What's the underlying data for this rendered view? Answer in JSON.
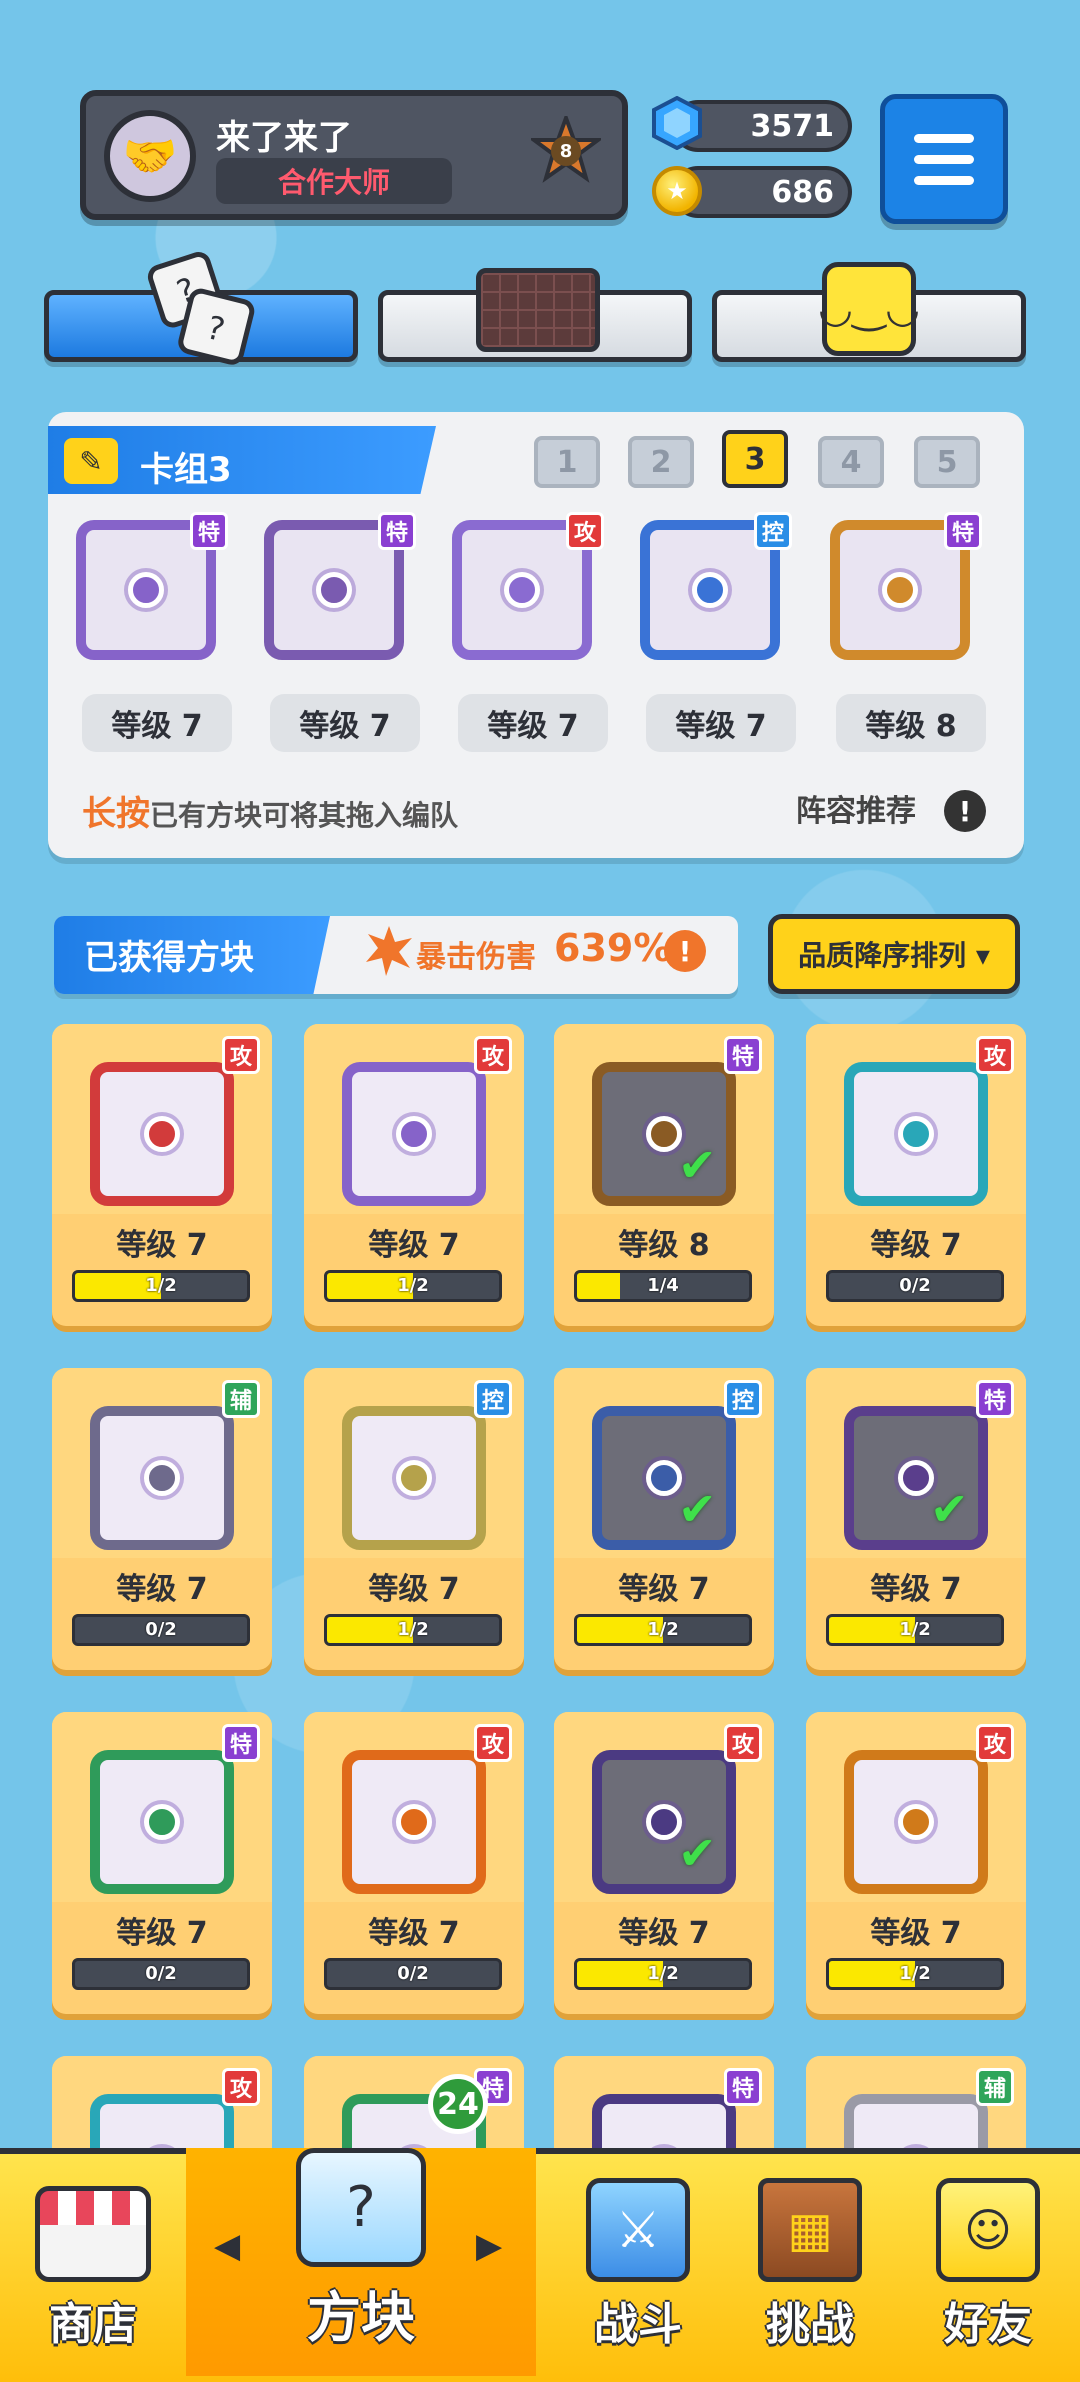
{
  "profile": {
    "name": "来了来了",
    "title": "合作大师",
    "rank_level": "8",
    "avatar_icon": "handshake-icon"
  },
  "currency": {
    "gems": "3571",
    "coins": "686"
  },
  "deck": {
    "title": "卡组3",
    "slots": [
      "1",
      "2",
      "3",
      "4",
      "5"
    ],
    "active_slot": "3",
    "cards": [
      {
        "type": "特",
        "level": "等级 7",
        "color": "#8663c9"
      },
      {
        "type": "特",
        "level": "等级 7",
        "color": "#7a5bb0"
      },
      {
        "type": "攻",
        "level": "等级 7",
        "color": "#8a6bd1"
      },
      {
        "type": "控",
        "level": "等级 7",
        "color": "#3a73d6"
      },
      {
        "type": "特",
        "level": "等级 8",
        "color": "#d08a2c"
      }
    ],
    "hint_em": "长按",
    "hint_text": "已有方块可将其拖入编队",
    "recommend": "阵容推荐"
  },
  "obtained": {
    "title": "已获得方块",
    "crit_label": "暴击伤害",
    "crit_value": "639%",
    "sort_label": "品质降序排列 ▾"
  },
  "grid": [
    {
      "type": "攻",
      "level": "等级 7",
      "progress": "1/2",
      "fraction": 0.5,
      "checked": false,
      "color": "#d23b3b"
    },
    {
      "type": "攻",
      "level": "等级 7",
      "progress": "1/2",
      "fraction": 0.5,
      "checked": false,
      "color": "#8663c9"
    },
    {
      "type": "特",
      "level": "等级 8",
      "progress": "1/4",
      "fraction": 0.25,
      "checked": true,
      "color": "#8a5b24"
    },
    {
      "type": "攻",
      "level": "等级 7",
      "progress": "0/2",
      "fraction": 0,
      "checked": false,
      "color": "#29a7b8"
    },
    {
      "type": "辅",
      "level": "等级 7",
      "progress": "0/2",
      "fraction": 0,
      "checked": false,
      "color": "#6e6a8c"
    },
    {
      "type": "控",
      "level": "等级 7",
      "progress": "1/2",
      "fraction": 0.5,
      "checked": false,
      "color": "#b5a24b"
    },
    {
      "type": "控",
      "level": "等级 7",
      "progress": "1/2",
      "fraction": 0.5,
      "checked": true,
      "color": "#3b5da8"
    },
    {
      "type": "特",
      "level": "等级 7",
      "progress": "1/2",
      "fraction": 0.5,
      "checked": true,
      "color": "#5a3e8c"
    },
    {
      "type": "特",
      "level": "等级 7",
      "progress": "0/2",
      "fraction": 0,
      "checked": false,
      "color": "#2f9b5a"
    },
    {
      "type": "攻",
      "level": "等级 7",
      "progress": "0/2",
      "fraction": 0,
      "checked": false,
      "color": "#e06a1a"
    },
    {
      "type": "攻",
      "level": "等级 7",
      "progress": "1/2",
      "fraction": 0.5,
      "checked": true,
      "color": "#4b3a82"
    },
    {
      "type": "攻",
      "level": "等级 7",
      "progress": "1/2",
      "fraction": 0.5,
      "checked": false,
      "color": "#d07a1a"
    },
    {
      "type": "攻",
      "level": "",
      "progress": "",
      "fraction": 0,
      "checked": false,
      "color": "#29a7b8"
    },
    {
      "type": "特",
      "level": "",
      "progress": "",
      "fraction": 0,
      "checked": false,
      "color": "#2f9b5a"
    },
    {
      "type": "特",
      "level": "",
      "progress": "",
      "fraction": 0,
      "checked": false,
      "color": "#4b3a82"
    },
    {
      "type": "辅",
      "level": "",
      "progress": "",
      "fraction": 0,
      "checked": false,
      "color": "#9a9aa6"
    }
  ],
  "type_colors": {
    "攻": "#e23a3a",
    "特": "#8a3fd1",
    "控": "#2a8ee6",
    "辅": "#2fa55a"
  },
  "nav": {
    "shop": "商店",
    "blocks": "方块",
    "battle": "战斗",
    "challenge": "挑战",
    "friends": "好友",
    "blocks_badge": "24"
  }
}
